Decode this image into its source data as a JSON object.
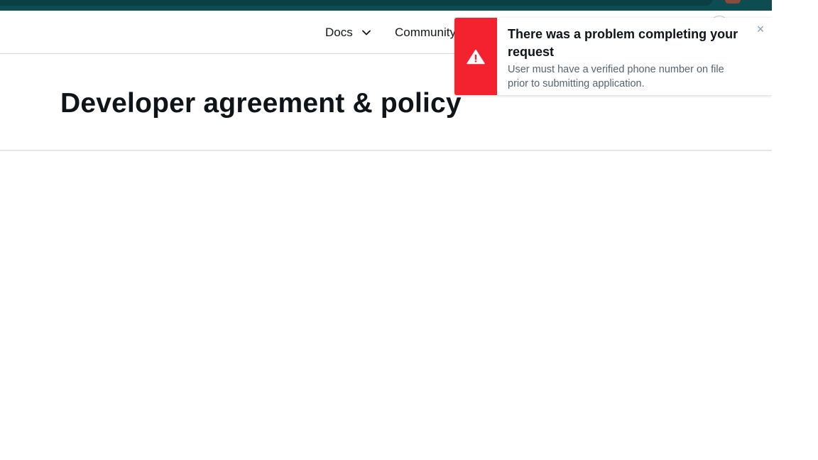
{
  "header": {
    "nav": {
      "docs_label": "Docs",
      "community_label": "Community"
    }
  },
  "main": {
    "page_title": "Developer agreement & policy"
  },
  "toast": {
    "title": "There was a problem completing your request",
    "message": "User must have a verified phone number on file prior to submitting application.",
    "close_glyph": "×",
    "icon": "warning-triangle-icon",
    "accent_color": "#f4212e"
  },
  "colors": {
    "top_bar": "#0d4d52",
    "error": "#f4212e",
    "text": "#0f1419",
    "secondary_text": "#536471"
  }
}
